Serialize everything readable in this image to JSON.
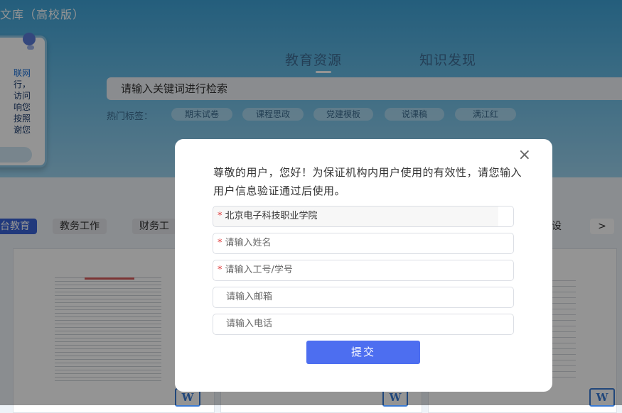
{
  "brand": "文库（高校版）",
  "notice": {
    "text_blue": "联网",
    "text": "行，\n访问\n响您\n按照\n谢您"
  },
  "hero_tabs": [
    "教育资源",
    "知识发现"
  ],
  "search": {
    "placeholder": "请输入关键词进行检索"
  },
  "hot_tags": {
    "label": "热门标签：",
    "items": [
      "期末试卷",
      "课程思政",
      "党建模板",
      "说课稿",
      "满江红"
    ]
  },
  "categories": [
    "台教育",
    "教务工作",
    "财务工",
    "设"
  ],
  "category_next": ">",
  "doc_icon_label": "W",
  "modal": {
    "close": "×",
    "message": "尊敬的用户，您好！为保证机构内用户使用的有效性，请您输入用户信息验证通过后使用。",
    "required_mark": "*",
    "fields": {
      "school": "北京电子科技职业学院",
      "name": "请输入姓名",
      "id": "请输入工号/学号",
      "email": "请输入邮箱",
      "phone": "请输入电话"
    },
    "submit": "提交"
  }
}
